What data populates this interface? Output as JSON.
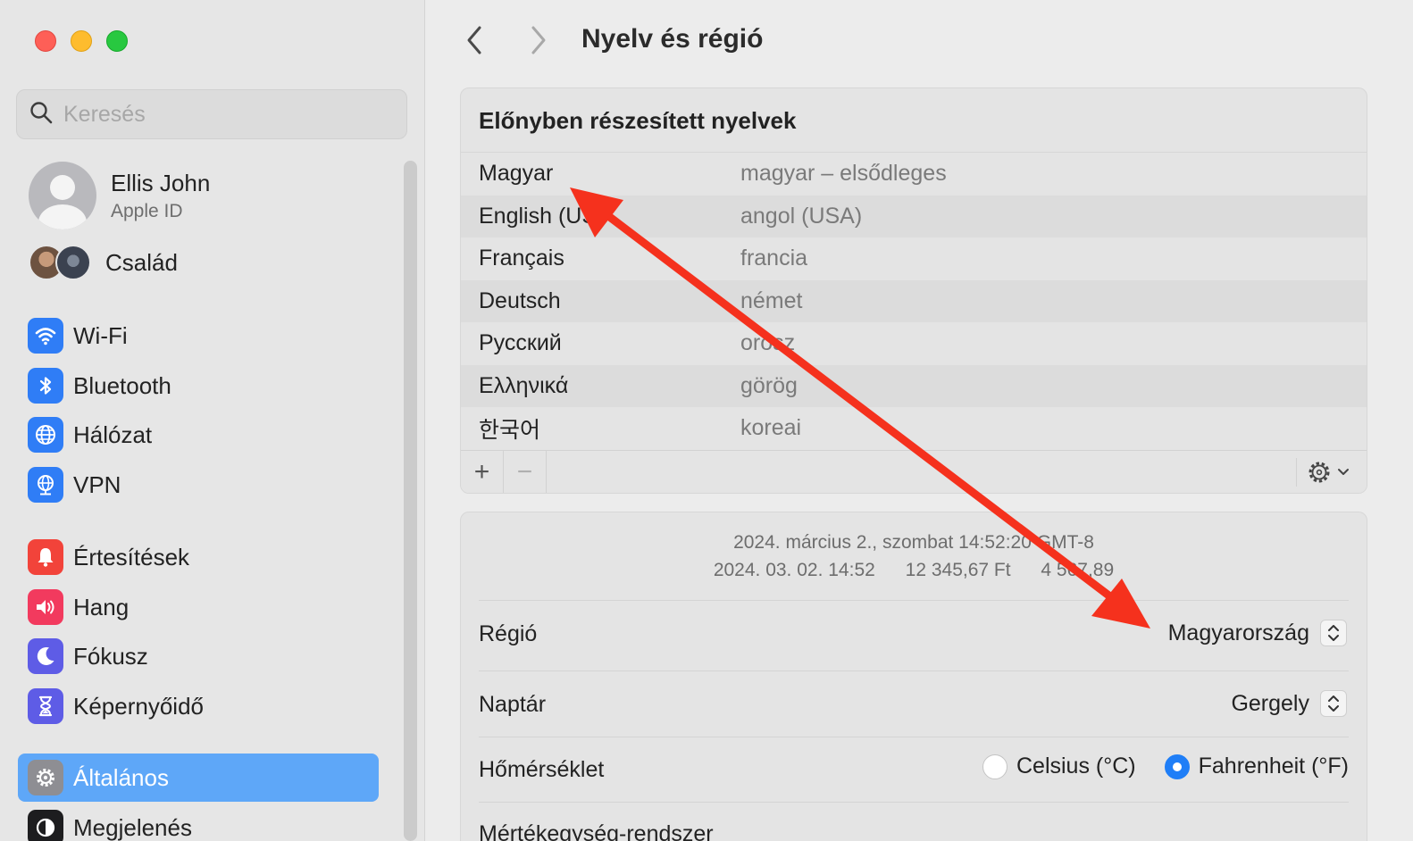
{
  "window": {
    "title": "Nyelv és régió"
  },
  "sidebar": {
    "search_placeholder": "Keresés",
    "account": {
      "name": "Ellis John",
      "subtitle": "Apple ID"
    },
    "family_label": "Család",
    "items": [
      {
        "label": "Wi-Fi",
        "icon": "wifi-icon",
        "color": "#2f7df6"
      },
      {
        "label": "Bluetooth",
        "icon": "bluetooth-icon",
        "color": "#2f7df6"
      },
      {
        "label": "Hálózat",
        "icon": "globe-icon",
        "color": "#2f7df6"
      },
      {
        "label": "VPN",
        "icon": "vpn-globe-icon",
        "color": "#2f7df6"
      },
      {
        "label": "Értesítések",
        "icon": "bell-icon",
        "color": "#f2433a"
      },
      {
        "label": "Hang",
        "icon": "speaker-icon",
        "color": "#f23a5e"
      },
      {
        "label": "Fókusz",
        "icon": "moon-icon",
        "color": "#5e5ce6"
      },
      {
        "label": "Képernyőidő",
        "icon": "hourglass-icon",
        "color": "#5e5ce6"
      },
      {
        "label": "Általános",
        "icon": "gear-icon",
        "color": "#8e8e93",
        "selected": true
      },
      {
        "label": "Megjelenés",
        "icon": "appearance-icon",
        "color": "#1d1d1f"
      }
    ]
  },
  "languages": {
    "title": "Előnyben részesített nyelvek",
    "rows": [
      {
        "name": "Magyar",
        "desc": "magyar – elsődleges"
      },
      {
        "name": "English (US)",
        "desc": "angol (USA)"
      },
      {
        "name": "Français",
        "desc": "francia"
      },
      {
        "name": "Deutsch",
        "desc": "német"
      },
      {
        "name": "Русский",
        "desc": "orosz"
      },
      {
        "name": "Ελληνικά",
        "desc": "görög"
      },
      {
        "name": "한국어",
        "desc": "koreai"
      }
    ],
    "add_label": "+",
    "remove_label": "−"
  },
  "region_panel": {
    "preview_line1": "2024. március 2., szombat 14:52:20 GMT-8",
    "preview_date": "2024. 03. 02. 14:52",
    "preview_currency": "12 345,67 Ft",
    "preview_number": "4 567,89",
    "region_label": "Régió",
    "region_value": "Magyarország",
    "calendar_label": "Naptár",
    "calendar_value": "Gergely",
    "temperature_label": "Hőmérséklet",
    "celsius_label": "Celsius (°C)",
    "fahrenheit_label": "Fahrenheit (°F)",
    "temperature_selected": "fahrenheit",
    "measurement_label": "Mértékegység-rendszer"
  },
  "colors": {
    "accent": "#1f7ef7",
    "selection": "#5ea7f8",
    "annotation_arrow": "#f5311d"
  }
}
